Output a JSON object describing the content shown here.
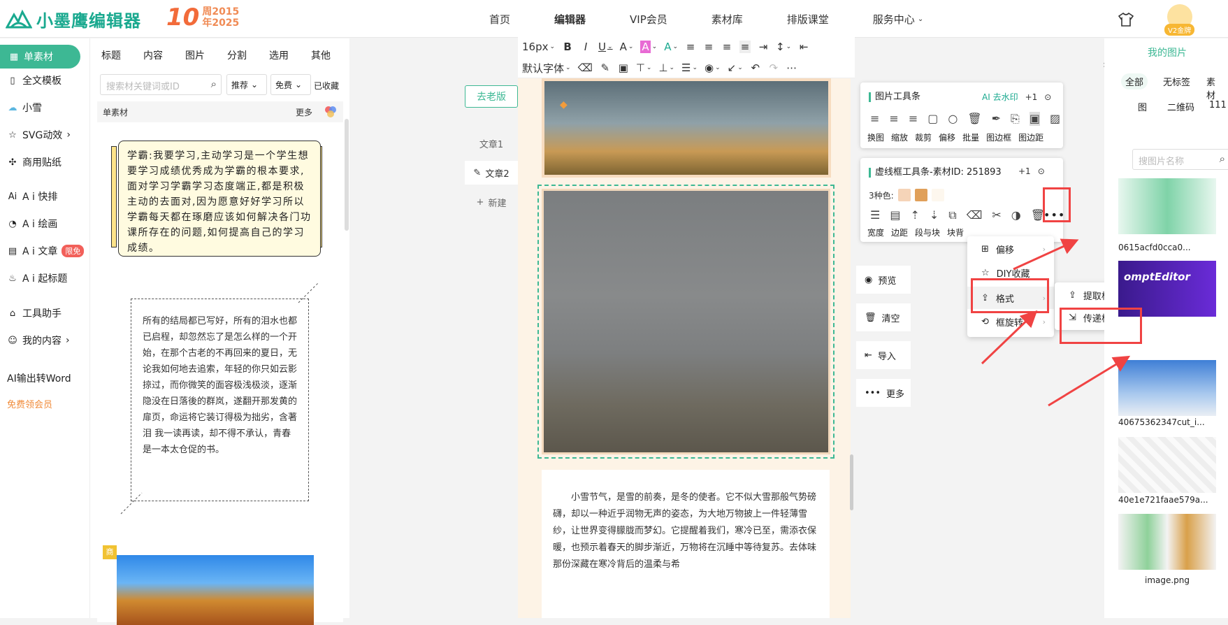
{
  "header": {
    "logo_text": "小墨鹰编辑器",
    "anniv_num": "10",
    "anniv_line1": "周2015",
    "anniv_line2": "年2025",
    "nav": [
      "首页",
      "编辑器",
      "VIP会员",
      "素材库",
      "排版课堂",
      "服务中心"
    ],
    "vip_badge": "V2金牌"
  },
  "left_rail": {
    "items": [
      "单素材",
      "全文模板",
      "小雪",
      "SVG动效",
      "商用贴纸",
      "A i 快排",
      "A i 绘画",
      "A i 文章",
      "A i 起标题",
      "工具助手",
      "我的内容",
      "AI输出转Word",
      "免费领会员"
    ],
    "badge": "限免"
  },
  "material": {
    "tabs": [
      "标题",
      "内容",
      "图片",
      "分割",
      "选用",
      "其他"
    ],
    "search_placeholder": "搜索材关键词或ID",
    "sort": "推荐",
    "price": "免费",
    "fav": "已收藏",
    "subhead": "单素材",
    "more": "更多",
    "card1_text": "学霸:我要学习,主动学习是一个学生想要学习成绩优秀成为学霸的根本要求,面对学习学霸学习态度端正,都是积极主动的去面对,因为愿意好好学习所以学霸每天都在琢磨应该如何解决各门功课所存在的问题,如何提高自己的学习成绩。",
    "card2_text": "所有的结局都已写好，所有的泪水也都已启程，却忽然忘了是怎么样的一个开始，在那个古老的不再回来的夏日，无论我如何地去追索，年轻的你只如云影掠过，而你微笑的面容极浅极淡，逐渐隐没在日落後的群岚，遂翻开那发黄的扉页，命运将它装订得极为拙劣，含著泪 我一读再读，却不得不承认，青春是一本太仓促的书。",
    "card3_tag": "商"
  },
  "middle": {
    "back_old": "去老版",
    "articles": [
      "文章1",
      "文章2",
      "新建"
    ]
  },
  "toolbar": {
    "font_size": "16px",
    "font_family": "默认字体"
  },
  "editor": {
    "text": "小雪节气，是雪的前奏，是冬的使者。它不似大雪那般气势磅礴，却以一种近乎润物无声的姿态，为大地万物披上一件轻薄雪纱，让世界变得朦胧而梦幻。它提醒着我们，寒冷已至，需添衣保暖，也预示着春天的脚步渐近，万物将在沉睡中等待复苏。去体味那份深藏在寒冷背后的温柔与希"
  },
  "actions": [
    "预览",
    "清空",
    "导入",
    "更多"
  ],
  "image_toolbar": {
    "title": "图片工具条",
    "ai": "AI 去水印",
    "plus": "+1",
    "labels": [
      "换图",
      "缩放",
      "裁剪",
      "偏移",
      "批量",
      "图边框",
      "图边距"
    ]
  },
  "frame_toolbar": {
    "title": "虚线框工具条-素材ID: 251893",
    "plus": "+1",
    "colors_label": "3种色:",
    "colors": [
      "#f5d4b8",
      "#e0a05a",
      "#fdf7ee"
    ],
    "labels": [
      "宽度",
      "边距",
      "段与块",
      "块背"
    ]
  },
  "menu1": [
    "偏移",
    "DIY收藏",
    "格式",
    "框旋转"
  ],
  "menu2": [
    "提取格式",
    "传递格式"
  ],
  "image_panel": {
    "title": "我的图片",
    "filters": [
      "全部",
      "无标签",
      "素材"
    ],
    "filters2": [
      "图",
      "二维码",
      "111"
    ],
    "search_placeholder": "搜图片名称",
    "thumbs": [
      "0615acfd0cca0...",
      "40675362347cut_i...",
      "40e1e721faae579a...",
      "image.png"
    ],
    "prompt_title": "omptEditor"
  }
}
